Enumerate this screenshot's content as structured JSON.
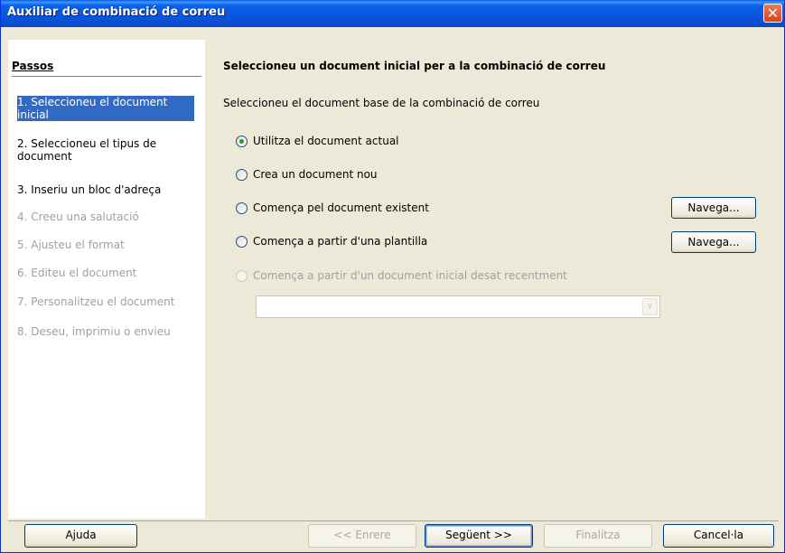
{
  "window": {
    "title": "Auxiliar de combinació de correu",
    "close_glyph": "✕"
  },
  "steps": {
    "title": "Passos",
    "items": [
      {
        "label": "1. Seleccioneu el document inicial",
        "state": "active"
      },
      {
        "label": "2. Seleccioneu el tipus de document",
        "state": "normal"
      },
      {
        "label": "3. Inseriu un bloc d'adreça",
        "state": "normal"
      },
      {
        "label": "4. Creeu una salutació",
        "state": "disabled"
      },
      {
        "label": "5. Ajusteu el format",
        "state": "disabled"
      },
      {
        "label": "6. Editeu el document",
        "state": "disabled"
      },
      {
        "label": "7. Personalitzeu el document",
        "state": "disabled"
      },
      {
        "label": "8. Deseu, imprimiu o envieu",
        "state": "disabled"
      }
    ]
  },
  "main": {
    "heading": "Seleccioneu un document inicial per a la combinació de correu",
    "description": "Seleccioneu el document base de la combinació de correu",
    "options": [
      {
        "label": "Utilitza el document actual",
        "checked": true,
        "enabled": true
      },
      {
        "label": "Crea un document nou",
        "checked": false,
        "enabled": true
      },
      {
        "label": "Comença pel document existent",
        "checked": false,
        "enabled": true
      },
      {
        "label": "Comença a partir d'una plantilla",
        "checked": false,
        "enabled": true
      },
      {
        "label": "Comença a partir d'un document inicial desat recentment",
        "checked": false,
        "enabled": false
      }
    ],
    "browse_label": "Navega...",
    "recent_combo": {
      "value": "",
      "arrow_glyph": "∨"
    }
  },
  "footer": {
    "help": "Ajuda",
    "back": "<< Enrere",
    "next": "Següent >>",
    "finish": "Finalitza",
    "cancel": "Cancel·la"
  }
}
